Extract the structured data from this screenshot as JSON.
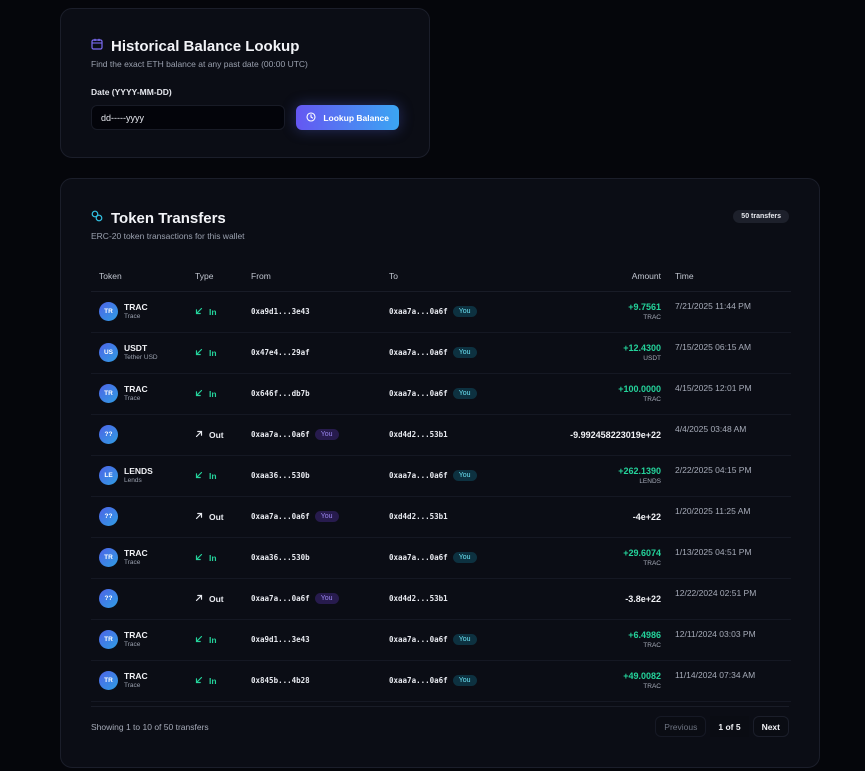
{
  "lookup": {
    "title": "Historical Balance Lookup",
    "subtitle": "Find the exact ETH balance at any past date (00:00 UTC)",
    "date_label": "Date (YYYY-MM-DD)",
    "date_placeholder": "dd-----yyyy",
    "button_label": "Lookup Balance",
    "icon": "calendar-icon"
  },
  "transfers": {
    "title": "Token Transfers",
    "subtitle": "ERC-20 token transactions for this wallet",
    "count_badge": "50 transfers",
    "columns": [
      "Token",
      "Type",
      "From",
      "To",
      "Amount",
      "Time"
    ],
    "you_label": "You",
    "rows": [
      {
        "avatar": "TR",
        "symbol": "TRAC",
        "name": "Trace",
        "type": "In",
        "from": "0xa9d1...3e43",
        "from_you": false,
        "to": "0xaa7a...0a6f",
        "to_you": true,
        "amount": "+9.7561",
        "amount_symbol": "TRAC",
        "time": "7/21/2025 11:44 PM"
      },
      {
        "avatar": "US",
        "symbol": "USDT",
        "name": "Tether USD",
        "type": "In",
        "from": "0x47e4...29af",
        "from_you": false,
        "to": "0xaa7a...0a6f",
        "to_you": true,
        "amount": "+12.4300",
        "amount_symbol": "USDT",
        "time": "7/15/2025 06:15 AM"
      },
      {
        "avatar": "TR",
        "symbol": "TRAC",
        "name": "Trace",
        "type": "In",
        "from": "0x646f...db7b",
        "from_you": false,
        "to": "0xaa7a...0a6f",
        "to_you": true,
        "amount": "+100.0000",
        "amount_symbol": "TRAC",
        "time": "4/15/2025 12:01 PM"
      },
      {
        "avatar": "??",
        "symbol": "",
        "name": "",
        "type": "Out",
        "from": "0xaa7a...0a6f",
        "from_you": true,
        "to": "0xd4d2...53b1",
        "to_you": false,
        "amount": "-9.992458223019e+22",
        "amount_symbol": "",
        "time": "4/4/2025 03:48 AM"
      },
      {
        "avatar": "LE",
        "symbol": "LENDS",
        "name": "Lends",
        "type": "In",
        "from": "0xaa36...530b",
        "from_you": false,
        "to": "0xaa7a...0a6f",
        "to_you": true,
        "amount": "+262.1390",
        "amount_symbol": "LENDS",
        "time": "2/22/2025 04:15 PM"
      },
      {
        "avatar": "??",
        "symbol": "",
        "name": "",
        "type": "Out",
        "from": "0xaa7a...0a6f",
        "from_you": true,
        "to": "0xd4d2...53b1",
        "to_you": false,
        "amount": "-4e+22",
        "amount_symbol": "",
        "time": "1/20/2025 11:25 AM"
      },
      {
        "avatar": "TR",
        "symbol": "TRAC",
        "name": "Trace",
        "type": "In",
        "from": "0xaa36...530b",
        "from_you": false,
        "to": "0xaa7a...0a6f",
        "to_you": true,
        "amount": "+29.6074",
        "amount_symbol": "TRAC",
        "time": "1/13/2025 04:51 PM"
      },
      {
        "avatar": "??",
        "symbol": "",
        "name": "",
        "type": "Out",
        "from": "0xaa7a...0a6f",
        "from_you": true,
        "to": "0xd4d2...53b1",
        "to_you": false,
        "amount": "-3.8e+22",
        "amount_symbol": "",
        "time": "12/22/2024 02:51 PM"
      },
      {
        "avatar": "TR",
        "symbol": "TRAC",
        "name": "Trace",
        "type": "In",
        "from": "0xa9d1...3e43",
        "from_you": false,
        "to": "0xaa7a...0a6f",
        "to_you": true,
        "amount": "+6.4986",
        "amount_symbol": "TRAC",
        "time": "12/11/2024 03:03 PM"
      },
      {
        "avatar": "TR",
        "symbol": "TRAC",
        "name": "Trace",
        "type": "In",
        "from": "0x845b...4b28",
        "from_you": false,
        "to": "0xaa7a...0a6f",
        "to_you": true,
        "amount": "+49.0082",
        "amount_symbol": "TRAC",
        "time": "11/14/2024 07:34 AM"
      }
    ],
    "footer": {
      "showing": "Showing 1 to 10 of 50 transfers",
      "prev_label": "Previous",
      "page_label": "1 of 5",
      "next_label": "Next"
    }
  },
  "colors": {
    "background": "#05060b",
    "card": "#0b0d15",
    "positive": "#24d39b",
    "accent_start": "#6557f2",
    "accent_end": "#3ba5f3"
  }
}
